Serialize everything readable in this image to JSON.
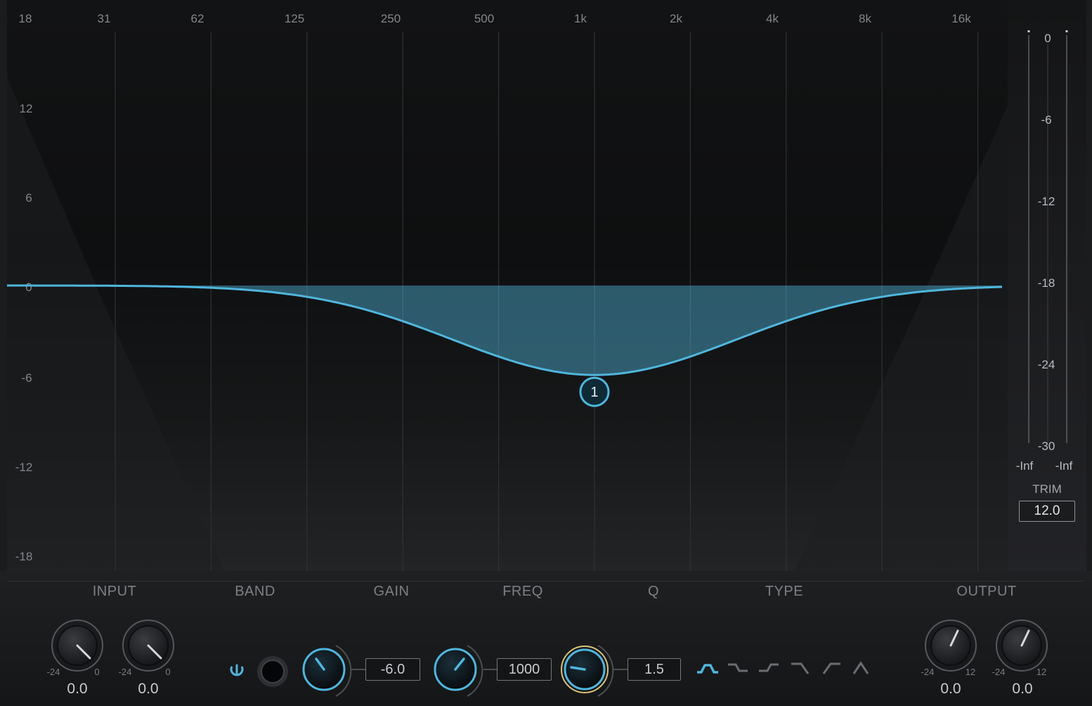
{
  "eq": {
    "frequency_labels": [
      "18",
      "31",
      "62",
      "125",
      "250",
      "500",
      "1k",
      "2k",
      "4k",
      "8k",
      "16k"
    ],
    "db_labels": [
      "12",
      "6",
      "0",
      "-6",
      "-12",
      "-18"
    ],
    "band_marker": "1",
    "band": {
      "type": "bell",
      "freq_hz": 1000,
      "gain_db": -6.0,
      "q": 1.5
    },
    "accent_color": "#4fb6dc"
  },
  "meter": {
    "scale_labels": [
      "0",
      "-6",
      "-12",
      "-18",
      "-24",
      "-30"
    ],
    "left_readout": "-Inf",
    "right_readout": "-Inf",
    "trim_label": "TRIM",
    "trim_value": "12.0"
  },
  "controls": {
    "input_label": "INPUT",
    "band_label": "BAND",
    "gain_label": "GAIN",
    "freq_label": "FREQ",
    "q_label": "Q",
    "type_label": "TYPE",
    "output_label": "OUTPUT",
    "input_knobs": [
      {
        "min": "-24",
        "max": "0",
        "value": "0.0"
      },
      {
        "min": "-24",
        "max": "0",
        "value": "0.0"
      }
    ],
    "output_knobs": [
      {
        "min": "-24",
        "max": "12",
        "value": "0.0"
      },
      {
        "min": "-24",
        "max": "12",
        "value": "0.0"
      }
    ],
    "gain_value": "-6.0",
    "freq_value": "1000",
    "q_value": "1.5",
    "band_power_icon": "power-icon",
    "filter_types": [
      "bell",
      "low-shelf",
      "high-shelf",
      "high-cut",
      "low-cut",
      "notch"
    ],
    "selected_filter": "bell"
  }
}
